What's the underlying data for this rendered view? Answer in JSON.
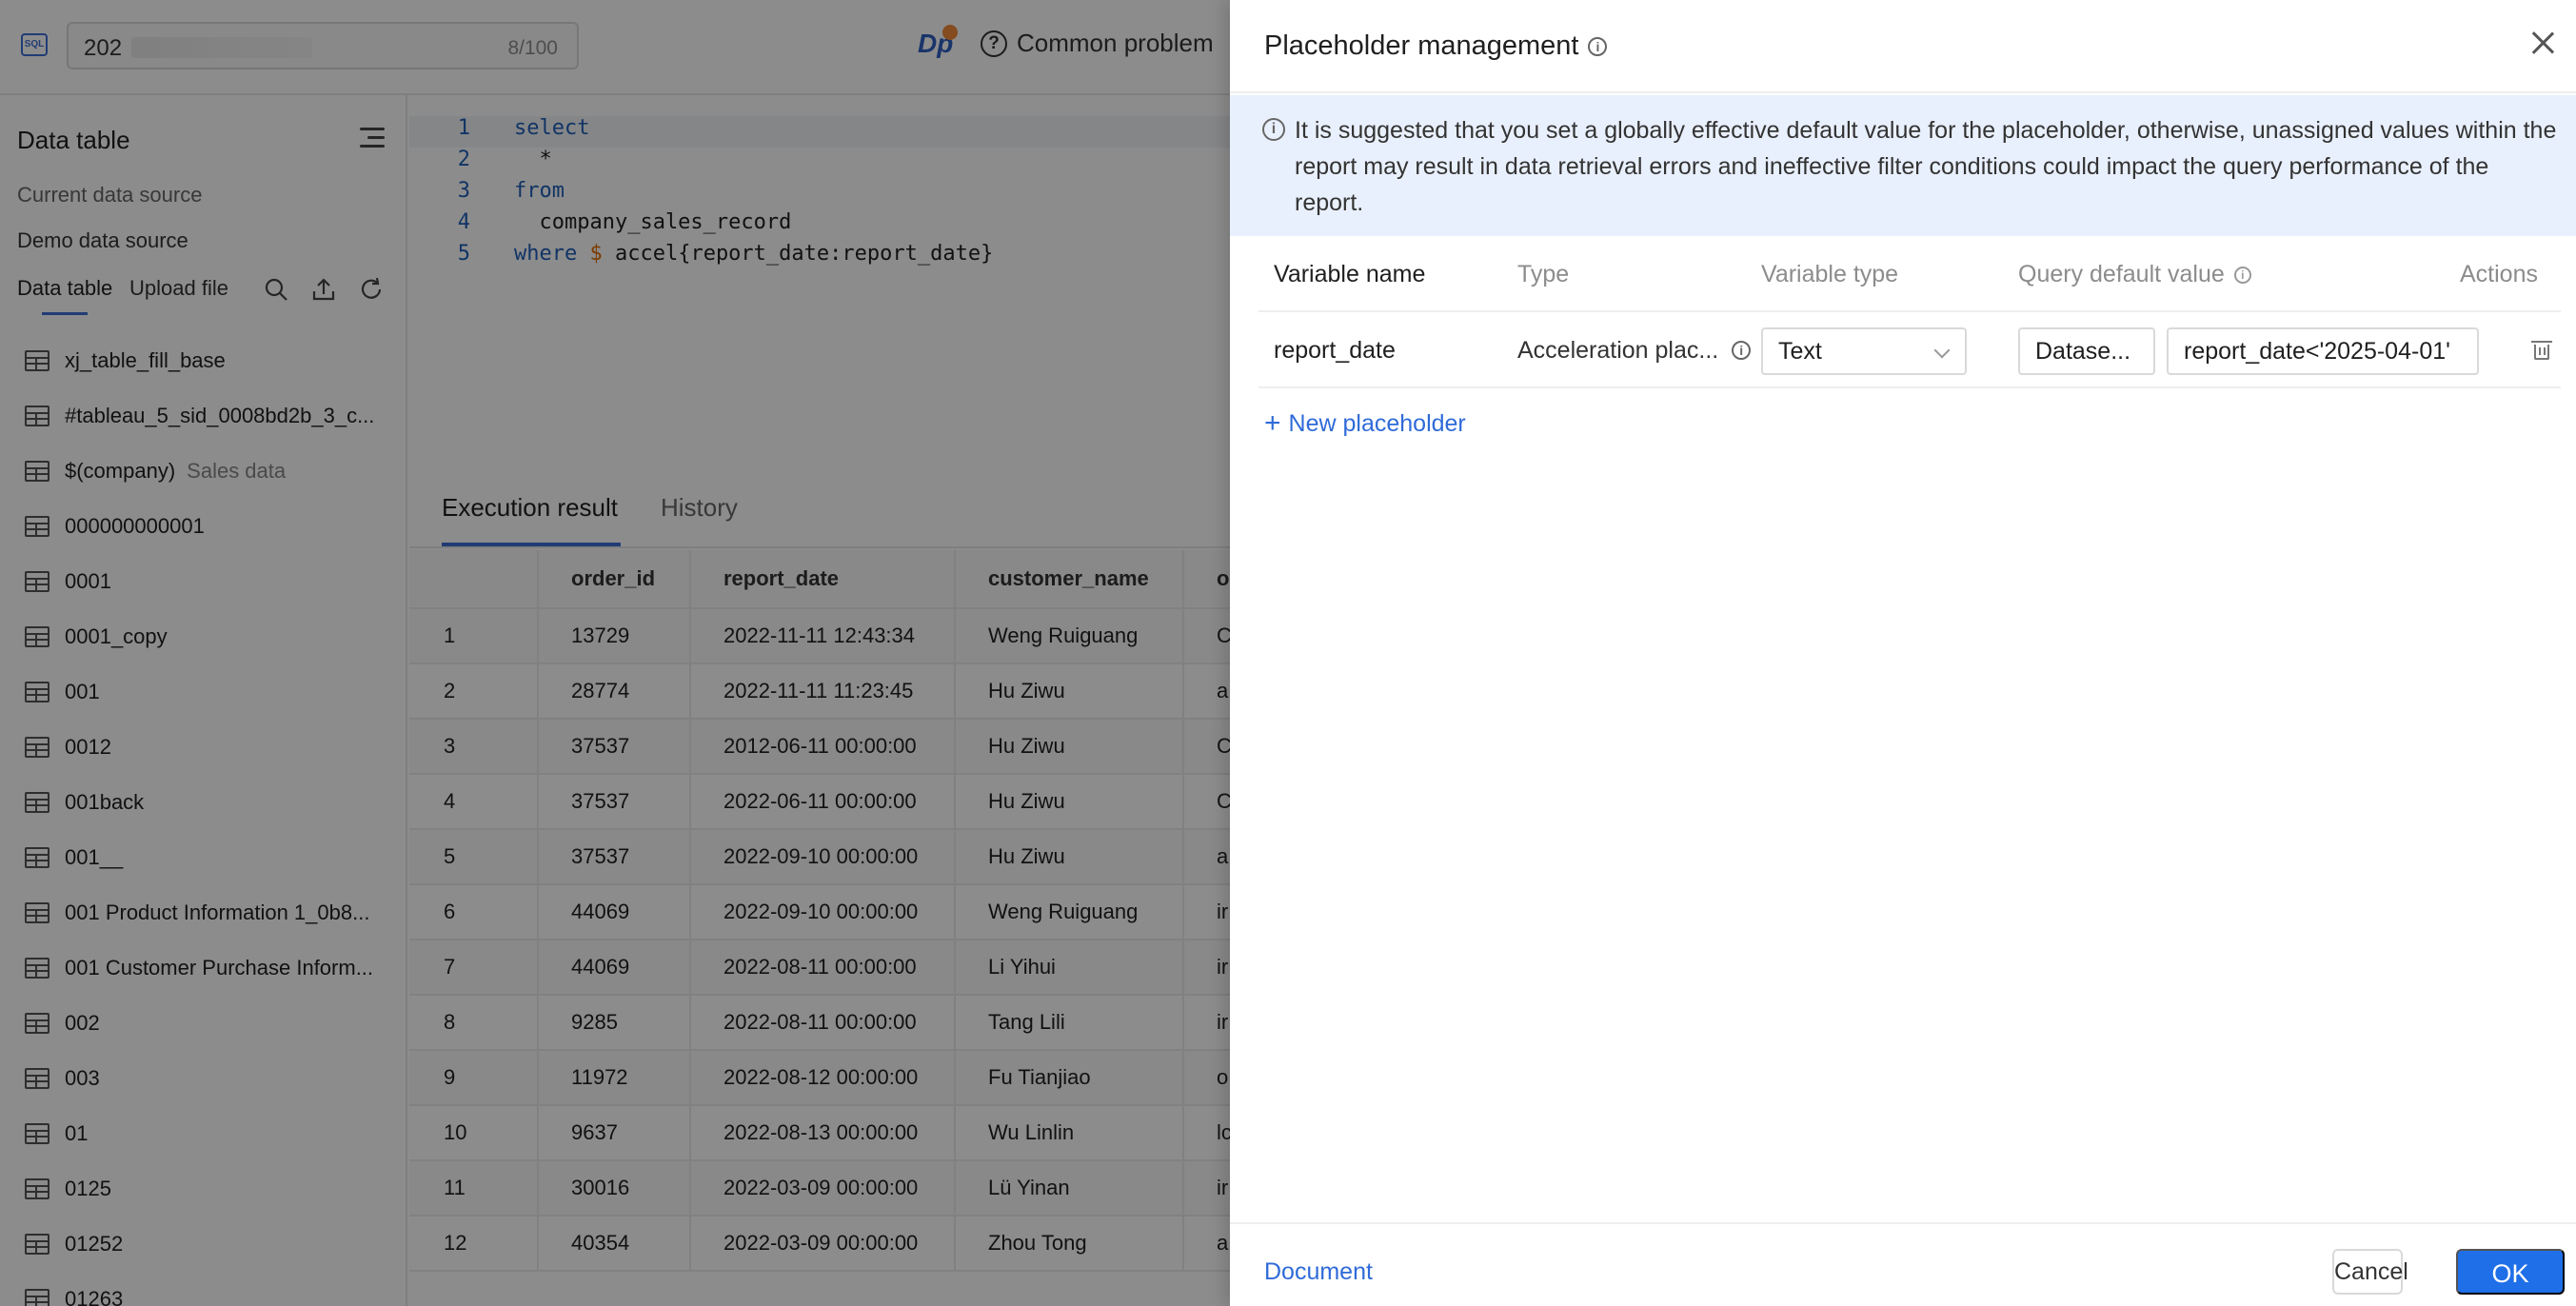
{
  "topbar": {
    "sql_badge": "SQL",
    "name_value": "202",
    "char_count": "8/100",
    "logo_text": "Dp",
    "help_label": "Common problem"
  },
  "sidebar": {
    "title": "Data table",
    "current_source_label": "Current data source",
    "source_name": "Demo data source",
    "tabs": {
      "data_table": "Data table",
      "upload_file": "Upload file"
    },
    "items": [
      {
        "name": "xj_table_fill_base",
        "sub": ""
      },
      {
        "name": "#tableau_5_sid_0008bd2b_3_c...",
        "sub": ""
      },
      {
        "name": "$(company)",
        "sub": "Sales data"
      },
      {
        "name": "000000000001",
        "sub": ""
      },
      {
        "name": "0001",
        "sub": ""
      },
      {
        "name": "0001_copy",
        "sub": ""
      },
      {
        "name": "001",
        "sub": ""
      },
      {
        "name": "0012",
        "sub": ""
      },
      {
        "name": "001back",
        "sub": ""
      },
      {
        "name": "001__",
        "sub": ""
      },
      {
        "name": "001 Product Information 1_0b8...",
        "sub": ""
      },
      {
        "name": "001 Customer Purchase Inform...",
        "sub": ""
      },
      {
        "name": "002",
        "sub": ""
      },
      {
        "name": "003",
        "sub": ""
      },
      {
        "name": "01",
        "sub": ""
      },
      {
        "name": "0125",
        "sub": ""
      },
      {
        "name": "01252",
        "sub": ""
      },
      {
        "name": "01263",
        "sub": ""
      }
    ]
  },
  "editor": {
    "lines": [
      {
        "n": "1",
        "kw": "select",
        "rest": ""
      },
      {
        "n": "2",
        "kw": "",
        "rest": "  *"
      },
      {
        "n": "3",
        "kw": "from",
        "rest": ""
      },
      {
        "n": "4",
        "kw": "",
        "rest": "  company_sales_record"
      },
      {
        "n": "5",
        "kw": "where",
        "sym": " $",
        "rest": " accel{report_date:report_date}"
      }
    ]
  },
  "results": {
    "tabs": {
      "execution": "Execution result",
      "history": "History"
    },
    "columns": [
      "",
      "order_id",
      "report_date",
      "customer_name",
      "o"
    ],
    "rows": [
      [
        "1",
        "13729",
        "2022-11-11 12:43:34",
        "Weng Ruiguang",
        "C"
      ],
      [
        "2",
        "28774",
        "2022-11-11 11:23:45",
        "Hu Ziwu",
        "a"
      ],
      [
        "3",
        "37537",
        "2012-06-11 00:00:00",
        "Hu Ziwu",
        "C"
      ],
      [
        "4",
        "37537",
        "2022-06-11 00:00:00",
        "Hu Ziwu",
        "C"
      ],
      [
        "5",
        "37537",
        "2022-09-10 00:00:00",
        "Hu Ziwu",
        "a"
      ],
      [
        "6",
        "44069",
        "2022-09-10 00:00:00",
        "Weng Ruiguang",
        "ir"
      ],
      [
        "7",
        "44069",
        "2022-08-11 00:00:00",
        "Li Yihui",
        "ir"
      ],
      [
        "8",
        "9285",
        "2022-08-11 00:00:00",
        "Tang Lili",
        "ir"
      ],
      [
        "9",
        "11972",
        "2022-08-12 00:00:00",
        "Fu Tianjiao",
        "o"
      ],
      [
        "10",
        "9637",
        "2022-08-13 00:00:00",
        "Wu Linlin",
        "lc"
      ],
      [
        "11",
        "30016",
        "2022-03-09 00:00:00",
        "Lü Yinan",
        "ir"
      ],
      [
        "12",
        "40354",
        "2022-03-09 00:00:00",
        "Zhou Tong",
        "a"
      ]
    ]
  },
  "drawer": {
    "title": "Placeholder management",
    "info_glyph": "i",
    "notice": "It is suggested that you set a globally effective default value for the placeholder, otherwise, unassigned values within the report may result in data retrieval errors and ineffective filter conditions could impact the query performance of the report.",
    "columns": {
      "variable_name": "Variable name",
      "type": "Type",
      "variable_type": "Variable type",
      "query_default": "Query default value",
      "actions": "Actions"
    },
    "rows": [
      {
        "variable_name": "report_date",
        "type": "Acceleration plac...",
        "variable_type": "Text",
        "default_source": "Datase...",
        "default_value": "report_date<'2025-04-01'"
      }
    ],
    "new_placeholder": "New placeholder",
    "plus_glyph": "+",
    "footer": {
      "document": "Document",
      "cancel": "Cancel",
      "ok": "OK"
    }
  },
  "colors": {
    "accent": "#1f6fe8",
    "link": "#2f6bd8",
    "notice_bg": "#e9f0fd",
    "mask": "rgba(0,0,0,0.45)"
  }
}
